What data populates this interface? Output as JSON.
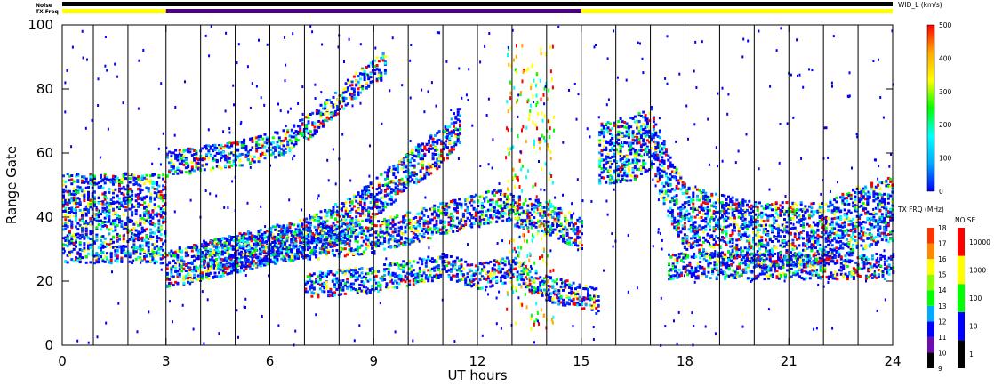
{
  "chart_data": {
    "type": "heatmap",
    "xlabel": "UT hours",
    "ylabel": "Range Gate",
    "xlim": [
      0,
      24
    ],
    "ylim": [
      0,
      100
    ],
    "x_ticks": [
      "0",
      "3",
      "6",
      "9",
      "12",
      "15",
      "18",
      "21",
      "24"
    ],
    "x_tick_values": [
      0,
      3,
      6,
      9,
      12,
      15,
      18,
      21,
      24
    ],
    "y_ticks": [
      "0",
      "20",
      "40",
      "60",
      "80",
      "100"
    ],
    "y_tick_values": [
      0,
      20,
      40,
      60,
      80,
      100
    ],
    "scan_boundaries_ut": [
      0.9,
      1.9,
      3.0,
      4.0,
      5.0,
      6.0,
      7.0,
      8.0,
      9.0,
      10.0,
      11.0,
      12.0,
      13.0,
      14.0,
      15.0,
      16.0,
      17.0,
      18.0,
      19.0,
      20.0,
      21.0,
      22.0,
      23.0
    ],
    "status_bars": {
      "noise_label": "Noise",
      "txfreq_label": "TX Freq",
      "noise_color": "#000000",
      "txfreq_segments": [
        {
          "start_ut": 0,
          "end_ut": 3,
          "color": "#ffff00"
        },
        {
          "start_ut": 3,
          "end_ut": 15,
          "color": "#4b0082"
        },
        {
          "start_ut": 15,
          "end_ut": 24,
          "color": "#ffff00"
        }
      ]
    },
    "echo_bands": [
      {
        "points": [
          [
            0,
            40
          ],
          [
            3,
            40
          ]
        ],
        "width": 14
      },
      {
        "points": [
          [
            3,
            57
          ],
          [
            5,
            60
          ],
          [
            6.5,
            64
          ],
          [
            7.5,
            72
          ],
          [
            8.5,
            82
          ],
          [
            9.3,
            88
          ]
        ],
        "width": 4
      },
      {
        "points": [
          [
            3,
            24
          ],
          [
            5,
            29
          ],
          [
            7,
            34
          ],
          [
            8.5,
            42
          ],
          [
            10,
            55
          ],
          [
            11,
            63
          ],
          [
            11.5,
            70
          ]
        ],
        "width": 6
      },
      {
        "points": [
          [
            4,
            28
          ],
          [
            7,
            32
          ],
          [
            9,
            34
          ],
          [
            11,
            40
          ],
          [
            12.5,
            44
          ],
          [
            14,
            40
          ],
          [
            15,
            35
          ]
        ],
        "width": 5
      },
      {
        "points": [
          [
            7,
            19
          ],
          [
            9,
            21
          ],
          [
            11,
            25
          ],
          [
            12,
            22
          ],
          [
            13,
            24
          ],
          [
            14,
            18
          ],
          [
            15.5,
            14
          ]
        ],
        "width": 4
      },
      {
        "points": [
          [
            15.5,
            60
          ],
          [
            16.5,
            62
          ],
          [
            17,
            65
          ],
          [
            17.5,
            50
          ],
          [
            18,
            40
          ],
          [
            20,
            35
          ],
          [
            22,
            35
          ],
          [
            23,
            40
          ],
          [
            24,
            43
          ]
        ],
        "width": 10
      },
      {
        "points": [
          [
            17.5,
            25
          ],
          [
            24,
            25
          ]
        ],
        "width": 4
      }
    ],
    "scatter_noise_region": {
      "x": [
        12.8,
        14.2
      ],
      "y": [
        5,
        95
      ]
    },
    "colorbars": [
      {
        "title": "WID_L (km/s)",
        "ticks": [
          "0",
          "100",
          "200",
          "300",
          "400",
          "500"
        ],
        "range": [
          0,
          500
        ],
        "colors": [
          "#0000ff",
          "#00aaff",
          "#00ffff",
          "#00ff00",
          "#ffff00",
          "#ffaa00",
          "#ff0000"
        ]
      },
      {
        "title": "TX FRQ (MHz)",
        "ticks": [
          "9",
          "10",
          "11",
          "12",
          "13",
          "14",
          "15",
          "16",
          "17",
          "18"
        ],
        "steps": [
          "#000000",
          "#6a0dad",
          "#0000ff",
          "#00aaff",
          "#00ff00",
          "#88ff00",
          "#ffff00",
          "#ff8800",
          "#ff3300"
        ]
      },
      {
        "title": "NOISE",
        "ticks": [
          "1",
          "10",
          "100",
          "1000",
          "10000"
        ],
        "steps": [
          "#000000",
          "#0000ff",
          "#00ff00",
          "#ffff00",
          "#ff0000"
        ]
      }
    ]
  }
}
